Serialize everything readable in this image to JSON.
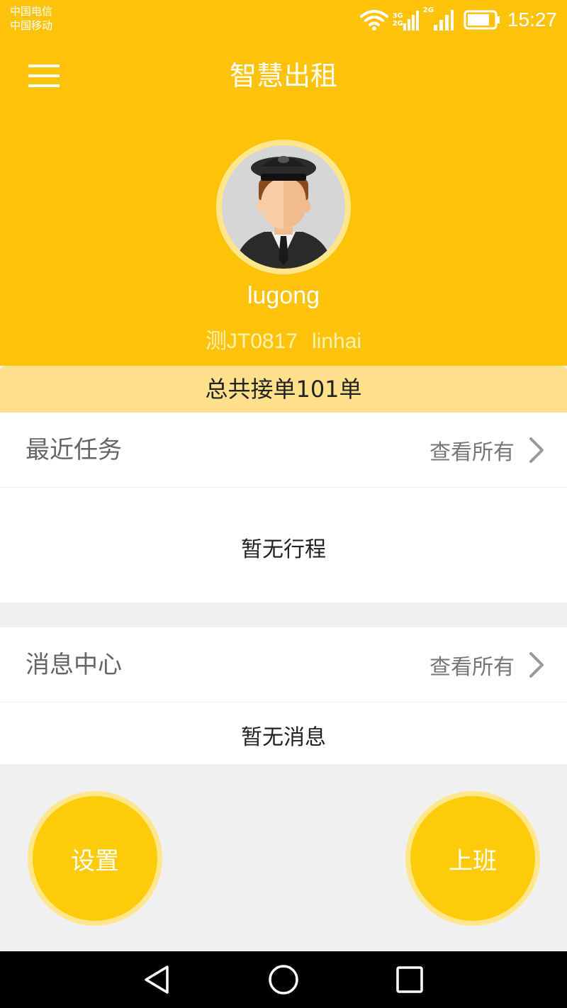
{
  "status_bar": {
    "carrier1": "中国电信",
    "carrier2": "中国移动",
    "sig1_top": "3G",
    "sig1_bottom": "2G",
    "sig2_label": "2G",
    "time": "15:27"
  },
  "app_bar": {
    "title": "智慧出租",
    "menu_icon": "hamburger-menu-icon"
  },
  "profile": {
    "avatar": "driver-avatar",
    "username": "lugong",
    "plate": "测JT0817",
    "company": "linhai"
  },
  "summary": {
    "total_orders": "总共接单101单"
  },
  "recent_tasks": {
    "title": "最近任务",
    "view_all": "查看所有",
    "empty": "暂无行程"
  },
  "messages": {
    "title": "消息中心",
    "view_all": "查看所有",
    "empty": "暂无消息"
  },
  "actions": {
    "settings": "设置",
    "go_on_duty": "上班"
  },
  "nav": {
    "back": "back-triangle-icon",
    "home": "home-circle-icon",
    "recents": "recents-square-icon"
  },
  "colors": {
    "primary": "#fdc30b",
    "banner": "#ffe08a",
    "background": "#f0f0f0"
  }
}
